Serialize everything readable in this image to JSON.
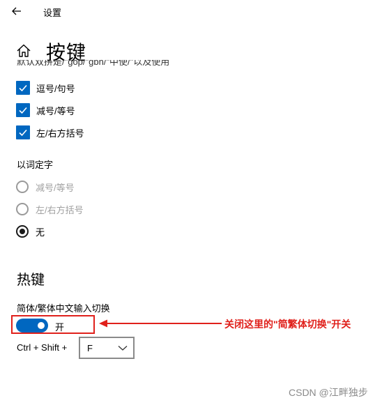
{
  "header": {
    "app_title": "设置",
    "back_icon": "back-arrow-icon"
  },
  "page": {
    "title": "按键",
    "home_icon": "home-icon",
    "cut_off_text": "默认双拼是/\"gop/\"gbn/\"中使/\"以及使用"
  },
  "checkboxes": [
    {
      "label": "逗号/句号",
      "checked": true
    },
    {
      "label": "减号/等号",
      "checked": true
    },
    {
      "label": "左/右方括号",
      "checked": true
    }
  ],
  "word_select": {
    "label": "以词定字",
    "options": [
      {
        "label": "减号/等号",
        "selected": false,
        "disabled": true
      },
      {
        "label": "左/右方括号",
        "selected": false,
        "disabled": true
      },
      {
        "label": "无",
        "selected": true,
        "disabled": false
      }
    ]
  },
  "hotkeys": {
    "title": "热键",
    "switch_label": "简体/繁体中文输入切换",
    "toggle_state": "开",
    "toggle_on": true,
    "shortcut_prefix": "Ctrl + Shift +",
    "shortcut_key": "F"
  },
  "annotation": {
    "text": "关闭这里的\"简繁体切换\"开关",
    "color": "#e0201b"
  },
  "watermark": "CSDN @江畔独步",
  "colors": {
    "accent": "#0067c0",
    "annotation_red": "#e0201b"
  }
}
